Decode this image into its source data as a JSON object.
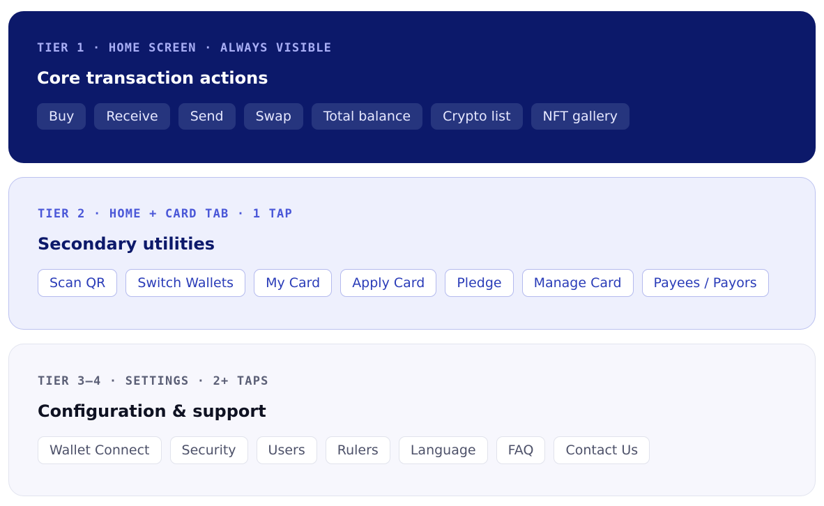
{
  "tiers": [
    {
      "eyebrow": "TIER 1 · HOME SCREEN · ALWAYS VISIBLE",
      "heading": "Core transaction actions",
      "items": [
        "Buy",
        "Receive",
        "Send",
        "Swap",
        "Total balance",
        "Crypto list",
        "NFT gallery"
      ]
    },
    {
      "eyebrow": "TIER 2 · HOME + CARD TAB · 1 TAP",
      "heading": "Secondary utilities",
      "items": [
        "Scan QR",
        "Switch Wallets",
        "My Card",
        "Apply Card",
        "Pledge",
        "Manage Card",
        "Payees / Payors"
      ]
    },
    {
      "eyebrow": "TIER 3–4 · SETTINGS · 2+ TAPS",
      "heading": "Configuration & support",
      "items": [
        "Wallet Connect",
        "Security",
        "Users",
        "Rulers",
        "Language",
        "FAQ",
        "Contact Us"
      ]
    }
  ],
  "colors": {
    "tier1_bg": "#0c196a",
    "tier2_bg": "#eef0fd",
    "tier3_bg": "#f7f7fd",
    "accent": "#4a57d8"
  }
}
